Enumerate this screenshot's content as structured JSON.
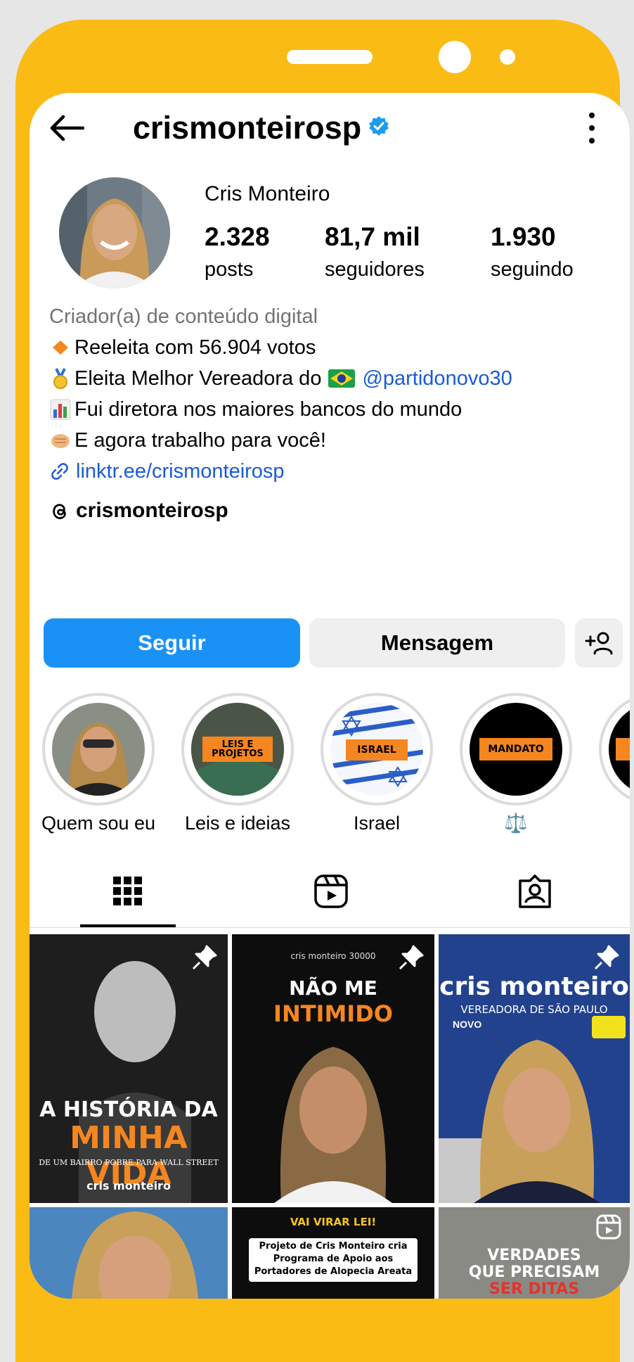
{
  "header": {
    "username": "crismonteirosp",
    "back_icon": "arrow-left-icon",
    "verified_icon": "verified-badge-icon",
    "more_icon": "more-vertical-icon"
  },
  "profile": {
    "full_name": "Cris Monteiro",
    "stats": [
      {
        "value": "2.328",
        "label": "posts"
      },
      {
        "value": "81,7 mil",
        "label": "seguidores"
      },
      {
        "value": "1.930",
        "label": "seguindo"
      }
    ],
    "category": "Criador(a) de conteúdo digital",
    "bio": {
      "line1": "Reeleita com 56.904 votos",
      "line2_text": "Eleita Melhor Vereadora do",
      "line2_mention": "@partidonovo30",
      "line3": "Fui diretora nos maiores bancos do mundo",
      "line4": "E agora trabalho para você!",
      "link": "linktr.ee/crismonteirosp"
    },
    "threads_handle": "crismonteirosp"
  },
  "actions": {
    "follow_label": "Seguir",
    "message_label": "Mensagem"
  },
  "highlights": [
    {
      "label": "Quem sou eu"
    },
    {
      "label": "Leis e ideias",
      "badge": "LEIS E PROJETOS"
    },
    {
      "label": "Israel",
      "badge": "ISRAEL"
    },
    {
      "label": "⚖️",
      "badge": "MANDATO"
    }
  ],
  "posts": {
    "p1_title1": "A HISTÓRIA DA",
    "p1_title2": "MINHA VIDA",
    "p1_sub": "DE UM BAIRRO POBRE PARA WALL STREET",
    "p1_brand": "cris monteiro",
    "p2_top": "cris monteiro 30000",
    "p2_title1": "NÃO ME",
    "p2_title2": "INTIMIDO",
    "p3_title": "cris monteiro",
    "p3_sub": "VEREADORA DE SÃO PAULO",
    "p3_party": "NOVO",
    "p5_banner": "VAI VIRAR LEI!",
    "p5_text1": "Projeto de Cris Monteiro cria",
    "p5_text2": "Programa de Apoio aos",
    "p5_text3": "Portadores de Alopecia Areata",
    "p6_text1": "VERDADES",
    "p6_text2": "QUE PRECISAM",
    "p6_text3": "SER DITAS"
  },
  "colors": {
    "frame": "#fbbb15",
    "follow_button": "#1a91f5",
    "link": "#1a5bd6",
    "orange_accent": "#f6861f"
  }
}
